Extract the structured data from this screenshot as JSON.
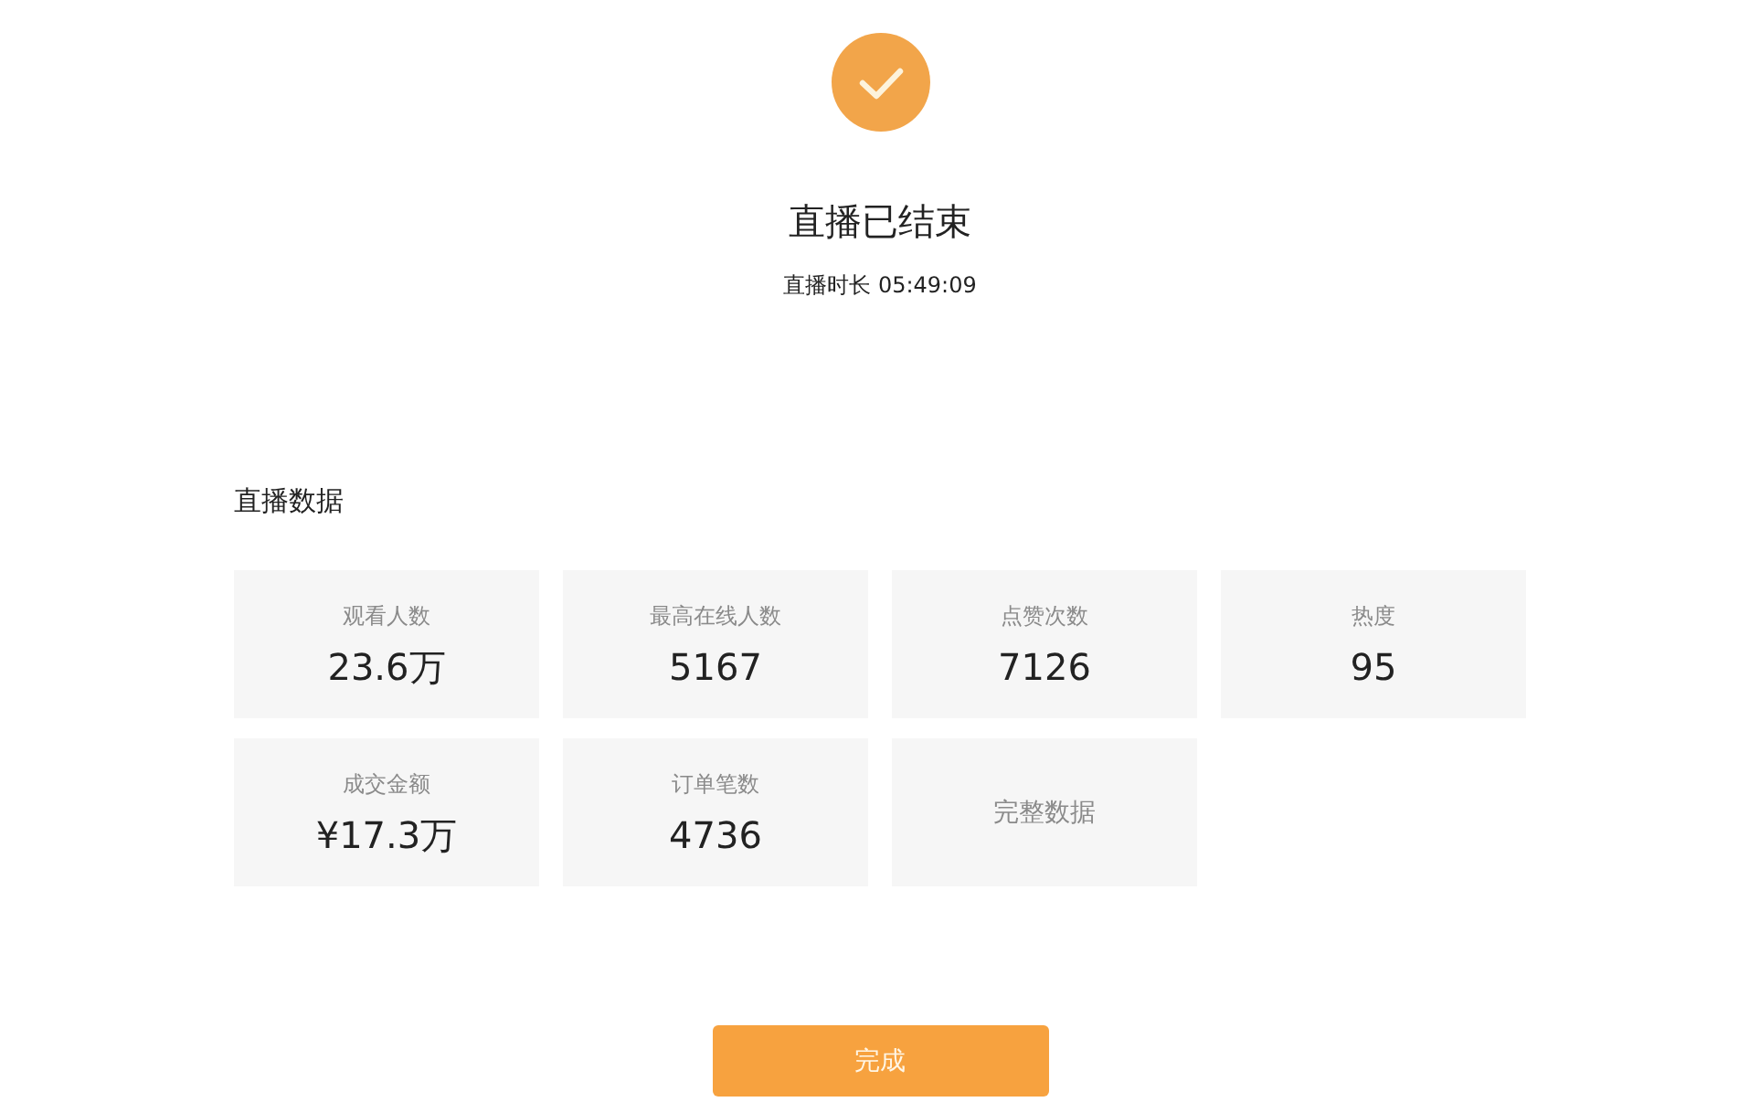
{
  "status": {
    "title": "直播已结束",
    "duration": "直播时长 05:49:09"
  },
  "section": {
    "title": "直播数据"
  },
  "stats": [
    {
      "kind": "metric",
      "label": "观看人数",
      "value": "23.6万"
    },
    {
      "kind": "metric",
      "label": "最高在线人数",
      "value": "5167"
    },
    {
      "kind": "metric",
      "label": "点赞次数",
      "value": "7126"
    },
    {
      "kind": "metric",
      "label": "热度",
      "value": "95"
    },
    {
      "kind": "metric",
      "label": "成交金额",
      "value": "¥17.3万"
    },
    {
      "kind": "metric",
      "label": "订单笔数",
      "value": "4736"
    },
    {
      "kind": "link",
      "label": "完整数据"
    }
  ],
  "buttons": [
    {
      "label": "完成"
    }
  ]
}
